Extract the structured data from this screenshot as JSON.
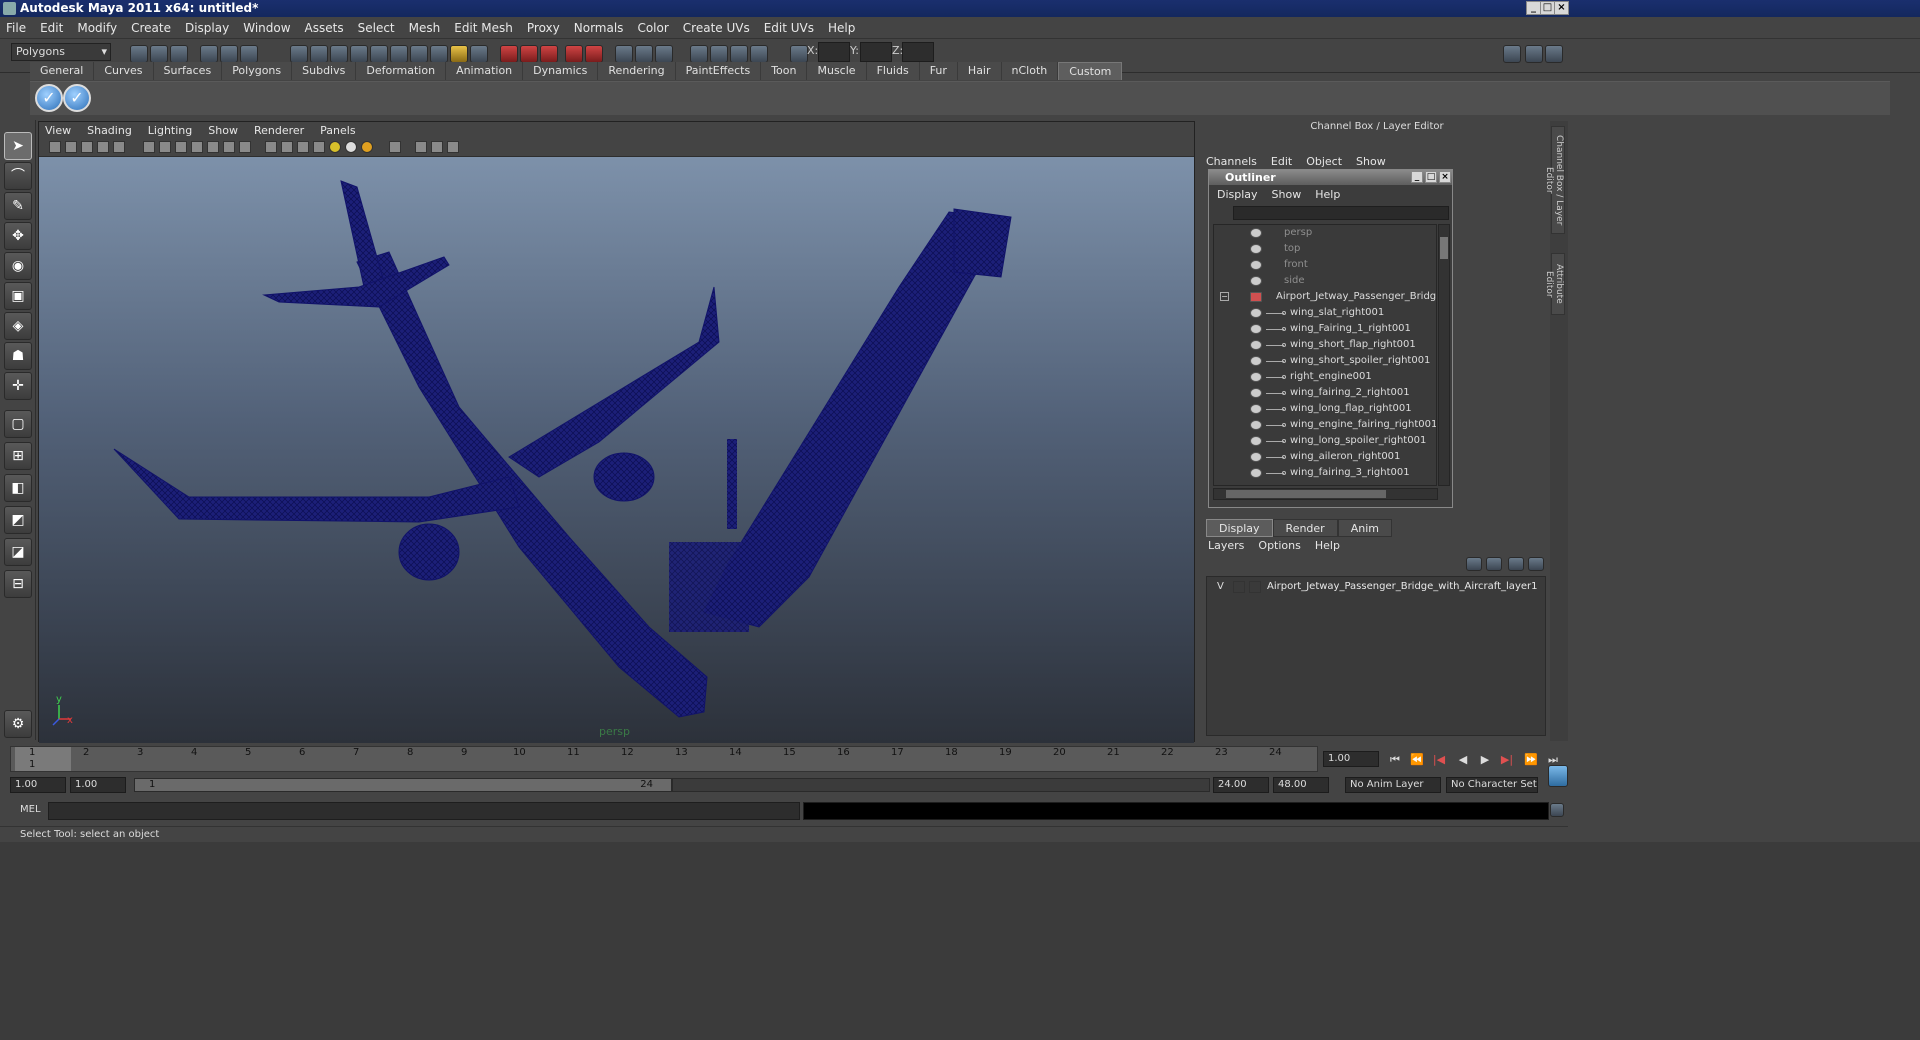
{
  "window": {
    "title": "Autodesk Maya 2011 x64: untitled*"
  },
  "menubar": [
    "File",
    "Edit",
    "Modify",
    "Create",
    "Display",
    "Window",
    "Assets",
    "Select",
    "Mesh",
    "Edit Mesh",
    "Proxy",
    "Normals",
    "Color",
    "Create UVs",
    "Edit UVs",
    "Help"
  ],
  "statusline": {
    "mode": "Polygons",
    "x_label": "X:",
    "y_label": "Y:",
    "z_label": "Z:"
  },
  "shelf": {
    "tabs": [
      "General",
      "Curves",
      "Surfaces",
      "Polygons",
      "Subdivs",
      "Deformation",
      "Animation",
      "Dynamics",
      "Rendering",
      "PaintEffects",
      "Toon",
      "Muscle",
      "Fluids",
      "Fur",
      "Hair",
      "nCloth",
      "Custom"
    ],
    "active_tab": "Custom"
  },
  "viewport": {
    "menu": [
      "View",
      "Shading",
      "Lighting",
      "Show",
      "Renderer",
      "Panels"
    ],
    "camera": "persp",
    "axis_y": "y",
    "axis_x": "x",
    "wire_color": "#16186b"
  },
  "channelbox": {
    "title": "Channel Box / Layer Editor",
    "menu": [
      "Channels",
      "Edit",
      "Object",
      "Show"
    ]
  },
  "outliner": {
    "title": "Outliner",
    "menu": [
      "Display",
      "Show",
      "Help"
    ],
    "cameras": [
      "persp",
      "top",
      "front",
      "side"
    ],
    "root": "Airport_Jetway_Passenger_Bridge_with_A",
    "children": [
      "wing_slat_right001",
      "wing_Fairing_1_right001",
      "wing_short_flap_right001",
      "wing_short_spoiler_right001",
      "right_engine001",
      "wing_fairing_2_right001",
      "wing_long_flap_right001",
      "wing_engine_fairing_right001",
      "wing_long_spoiler_right001",
      "wing_aileron_right001",
      "wing_fairing_3_right001"
    ]
  },
  "layers": {
    "tabs": [
      "Display",
      "Render",
      "Anim"
    ],
    "active_tab": "Display",
    "menu": [
      "Layers",
      "Options",
      "Help"
    ],
    "visible_flag": "V",
    "layer_name": "Airport_Jetway_Passenger_Bridge_with_Aircraft_layer1"
  },
  "side_tabs": [
    "Channel Box / Layer Editor",
    "Attribute Editor"
  ],
  "timeline": {
    "ticks": [
      "1",
      "2",
      "3",
      "4",
      "5",
      "6",
      "7",
      "8",
      "9",
      "10",
      "11",
      "12",
      "13",
      "14",
      "15",
      "16",
      "17",
      "18",
      "19",
      "20",
      "21",
      "22",
      "23",
      "24"
    ],
    "current_frame": "1",
    "current_time_field": "1.00"
  },
  "range": {
    "start": "1.00",
    "inner_start": "1.00",
    "range_min_label": "1",
    "range_max_label": "24",
    "end": "24.00",
    "outer_end": "48.00",
    "anim_layer": "No Anim Layer",
    "character_set": "No Character Set"
  },
  "command": {
    "label": "MEL"
  },
  "status": {
    "help": "Select Tool: select an object"
  }
}
